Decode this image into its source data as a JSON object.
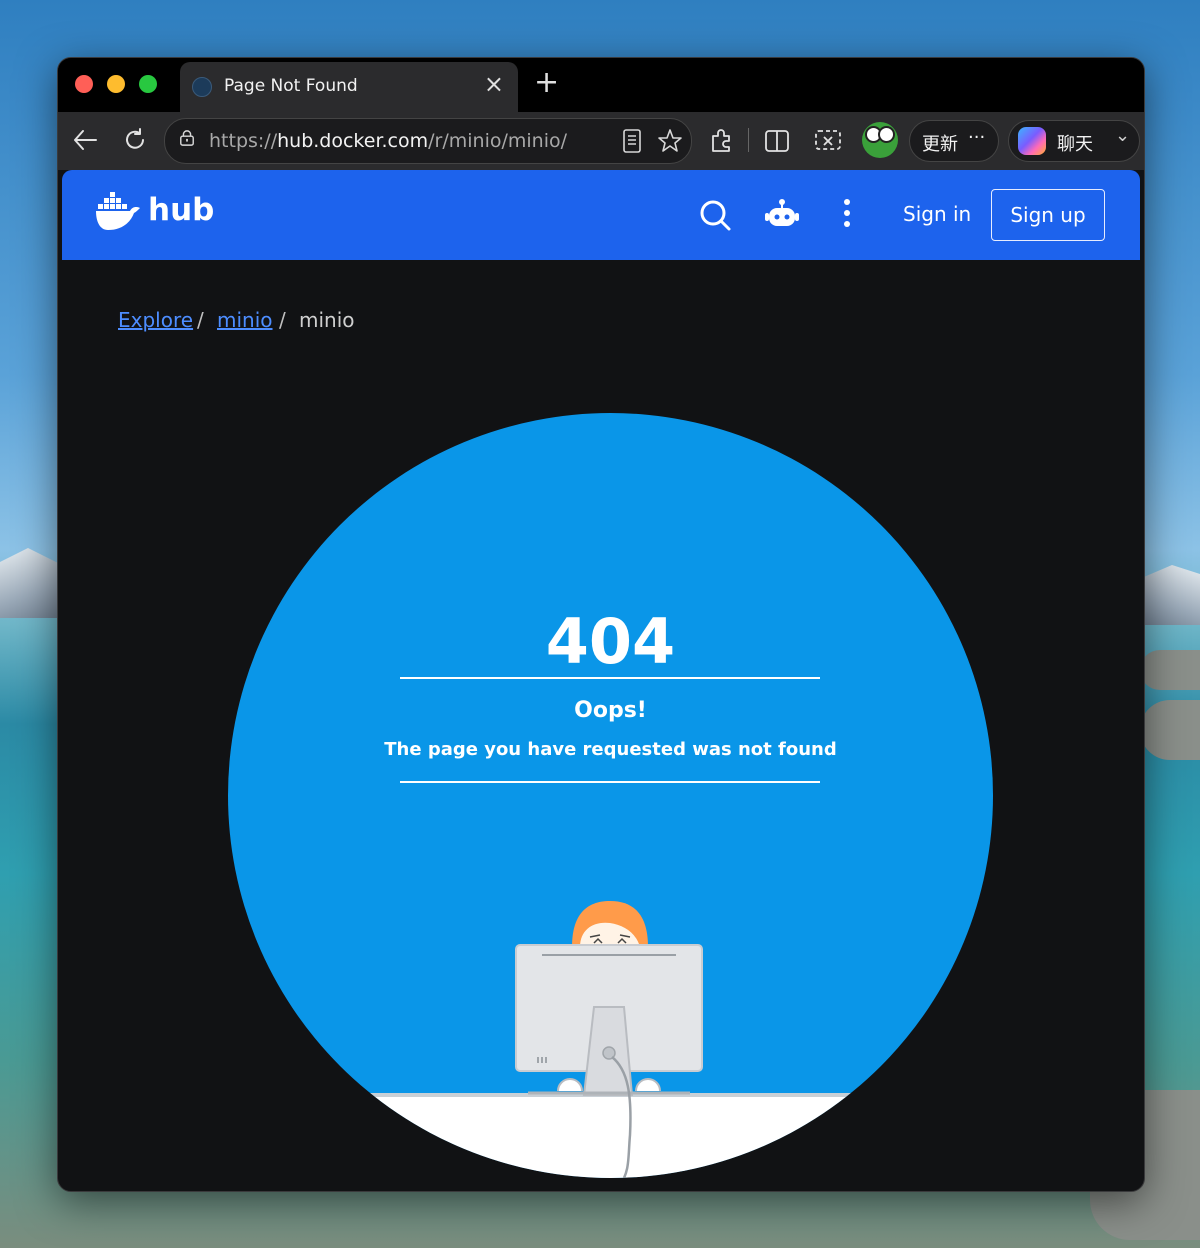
{
  "browser": {
    "tab": {
      "title": "Page Not Found",
      "close": "×"
    },
    "new_tab": "+",
    "address": {
      "url_prefix": "https://",
      "url_host": "hub.docker.com",
      "url_path": "/r/minio/minio/"
    },
    "update_label": "更新",
    "more": "···",
    "copilot_label": "聊天",
    "chevron": "⌄"
  },
  "header": {
    "logo_text": "hub",
    "sign_in": "Sign in",
    "sign_up": "Sign up",
    "brand_color": "#1d63ed"
  },
  "breadcrumb": {
    "items": [
      {
        "label": "Explore",
        "link": true
      },
      {
        "label": "minio",
        "link": true
      },
      {
        "label": "minio",
        "link": false
      }
    ],
    "separator": "/"
  },
  "error": {
    "code": "404",
    "title": "Oops!",
    "message": "The page you have requested was not found",
    "circle_color": "#0a96e8"
  }
}
